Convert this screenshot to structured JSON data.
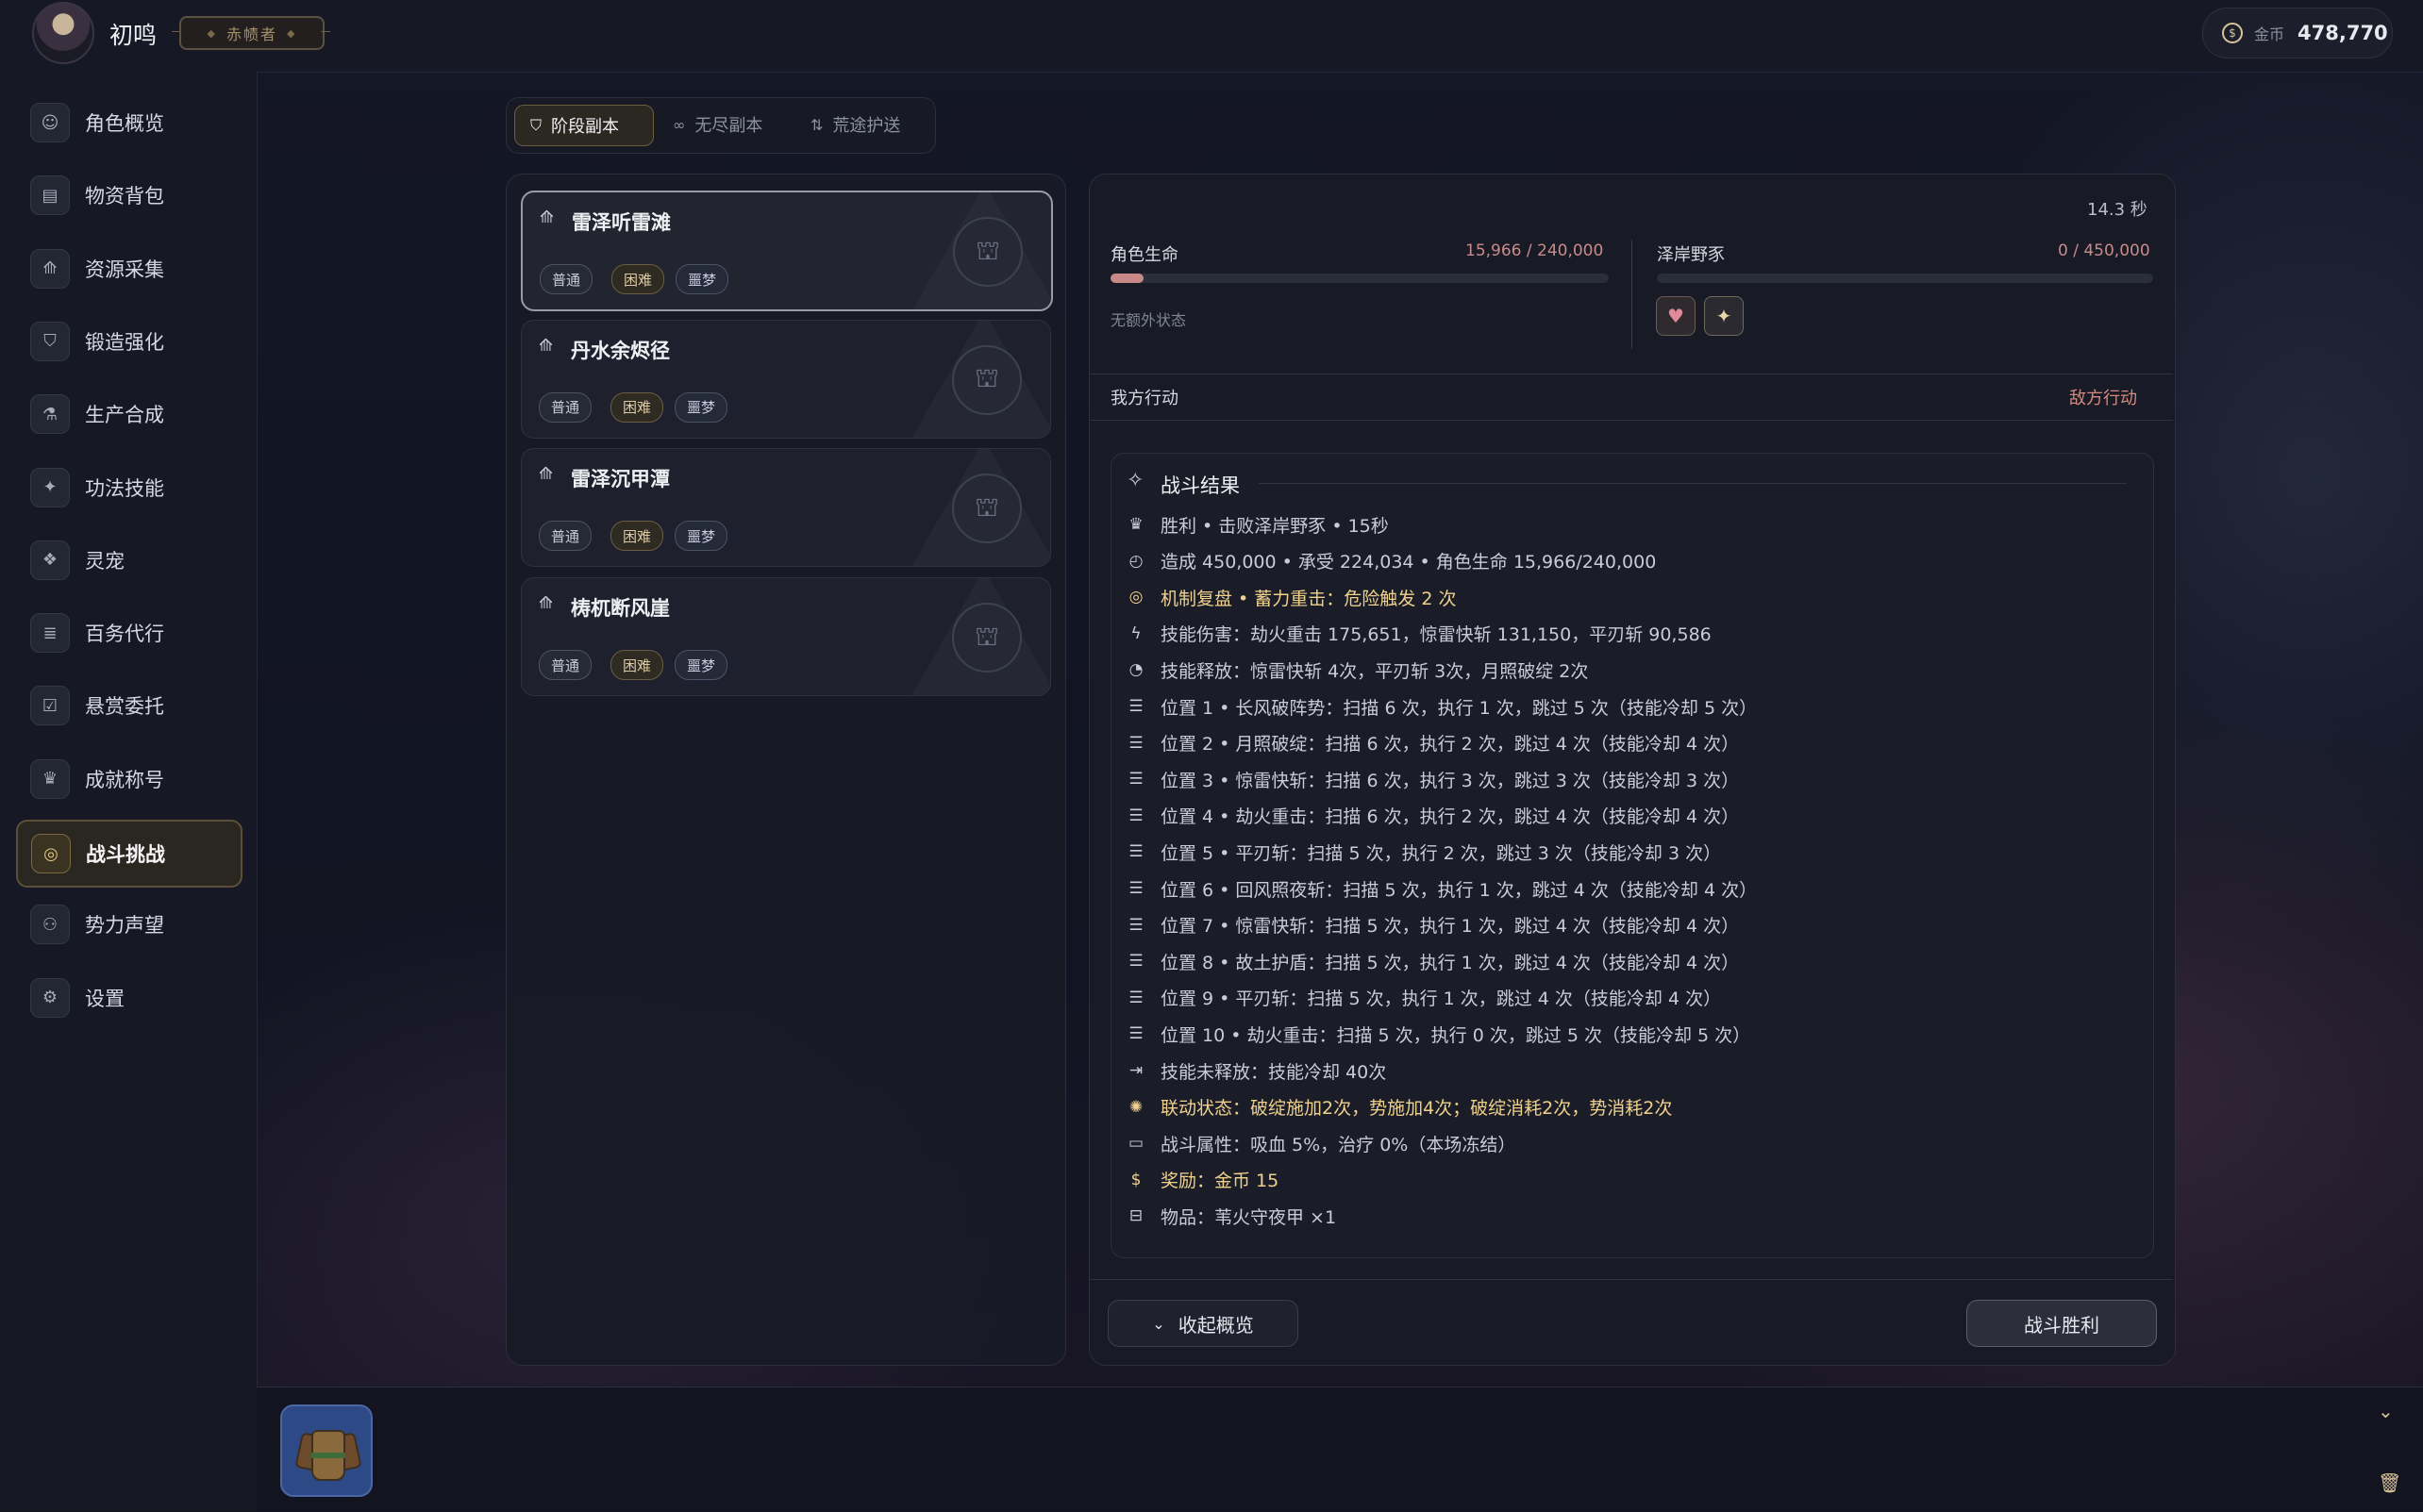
{
  "header": {
    "username": "初鸣",
    "rank": "赤帻者",
    "gold_label": "金币",
    "gold_value": "478,770"
  },
  "sidebar": {
    "items": [
      {
        "label": "角色概览",
        "icon": "person-icon"
      },
      {
        "label": "物资背包",
        "icon": "bag-icon"
      },
      {
        "label": "资源采集",
        "icon": "trees-icon"
      },
      {
        "label": "锻造强化",
        "icon": "shield-icon"
      },
      {
        "label": "生产合成",
        "icon": "flask-icon"
      },
      {
        "label": "功法技能",
        "icon": "sparkles-icon"
      },
      {
        "label": "灵宠",
        "icon": "paw-icon"
      },
      {
        "label": "百务代行",
        "icon": "list-check-icon"
      },
      {
        "label": "悬赏委托",
        "icon": "clipboard-check-icon"
      },
      {
        "label": "成就称号",
        "icon": "trophy-icon"
      },
      {
        "label": "战斗挑战",
        "icon": "swirl-icon",
        "active": true
      },
      {
        "label": "势力声望",
        "icon": "users-icon"
      },
      {
        "label": "设置",
        "icon": "gear-icon"
      }
    ]
  },
  "tabs": [
    {
      "label": "阶段副本",
      "icon": "shield-icon",
      "active": true
    },
    {
      "label": "无尽副本",
      "icon": "infinity-icon"
    },
    {
      "label": "荒途护送",
      "icon": "arrows-icon"
    }
  ],
  "dungeons": [
    {
      "name": "雷泽听雷滩",
      "tags": [
        "普通",
        "困难",
        "噩梦"
      ],
      "active": true
    },
    {
      "name": "丹水余烬径",
      "tags": [
        "普通",
        "困难",
        "噩梦"
      ]
    },
    {
      "name": "雷泽沉甲潭",
      "tags": [
        "普通",
        "困难",
        "噩梦"
      ]
    },
    {
      "name": "梼杌断风崖",
      "tags": [
        "普通",
        "困难",
        "噩梦"
      ]
    }
  ],
  "battle": {
    "timer": "14.3 秒",
    "player": {
      "label": "角色生命",
      "value": "15,966 / 240,000",
      "hp_fraction": 0.0665,
      "status": "无额外状态"
    },
    "enemy": {
      "label": "泽岸野豕",
      "value": "0 / 450,000",
      "hp_fraction": 0
    },
    "my_action": "我方行动",
    "enemy_action": "敌方行动",
    "result_title": "战斗结果",
    "lines": [
      {
        "icon": "trophy-icon",
        "text": "胜利 • 击败泽岸野豕 • 15秒",
        "gold": false
      },
      {
        "icon": "clock-icon",
        "text": "造成 450,000 • 承受 224,034 • 角色生命 15,966/240,000",
        "gold": false
      },
      {
        "icon": "swirl-icon",
        "text": "机制复盘 • 蓄力重击：危险触发 2 次",
        "gold": true
      },
      {
        "icon": "bolt-icon",
        "text": "技能伤害：劫火重击 175,651，惊雷快斩 131,150，平刃斩 90,586",
        "gold": false
      },
      {
        "icon": "gauge-icon",
        "text": "技能释放：惊雷快斩 4次，平刃斩 3次，月照破绽 2次",
        "gold": false
      },
      {
        "icon": "list-icon",
        "text": "位置 1 • 长风破阵势：扫描 6 次，执行 1 次，跳过 5 次（技能冷却 5 次）",
        "gold": false
      },
      {
        "icon": "list-icon",
        "text": "位置 2 • 月照破绽：扫描 6 次，执行 2 次，跳过 4 次（技能冷却 4 次）",
        "gold": false
      },
      {
        "icon": "list-icon",
        "text": "位置 3 • 惊雷快斩：扫描 6 次，执行 3 次，跳过 3 次（技能冷却 3 次）",
        "gold": false
      },
      {
        "icon": "list-icon",
        "text": "位置 4 • 劫火重击：扫描 6 次，执行 2 次，跳过 4 次（技能冷却 4 次）",
        "gold": false
      },
      {
        "icon": "list-icon",
        "text": "位置 5 • 平刃斩：扫描 5 次，执行 2 次，跳过 3 次（技能冷却 3 次）",
        "gold": false
      },
      {
        "icon": "list-icon",
        "text": "位置 6 • 回风照夜斩：扫描 5 次，执行 1 次，跳过 4 次（技能冷却 4 次）",
        "gold": false
      },
      {
        "icon": "list-icon",
        "text": "位置 7 • 惊雷快斩：扫描 5 次，执行 1 次，跳过 4 次（技能冷却 4 次）",
        "gold": false
      },
      {
        "icon": "list-icon",
        "text": "位置 8 • 故土护盾：扫描 5 次，执行 1 次，跳过 4 次（技能冷却 4 次）",
        "gold": false
      },
      {
        "icon": "list-icon",
        "text": "位置 9 • 平刃斩：扫描 5 次，执行 1 次，跳过 4 次（技能冷却 4 次）",
        "gold": false
      },
      {
        "icon": "list-icon",
        "text": "位置 10 • 劫火重击：扫描 5 次，执行 0 次，跳过 5 次（技能冷却 5 次）",
        "gold": false
      },
      {
        "icon": "skip-icon",
        "text": "技能未释放：技能冷却 40次",
        "gold": false
      },
      {
        "icon": "atom-icon",
        "text": "联动状态：破绽施加2次，势施加4次；破绽消耗2次，势消耗2次",
        "gold": true
      },
      {
        "icon": "card-icon",
        "text": "战斗属性：吸血 5%，治疗 0%（本场冻结）",
        "gold": false
      },
      {
        "icon": "coin-icon",
        "text": "奖励：金币 15",
        "gold": true
      },
      {
        "icon": "box-icon",
        "text": "物品：苇火守夜甲 ×1",
        "gold": false
      }
    ],
    "collapse_label": "收起概览",
    "victory_label": "战斗胜利"
  },
  "bottom": {
    "item_icon": "armor-icon"
  }
}
